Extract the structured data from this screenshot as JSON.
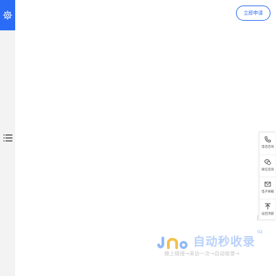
{
  "header": {
    "apply_label": "立即申请"
  },
  "sidebar": {
    "logo_icon": "gear-logo-icon",
    "menu_icon": "menu-list-icon",
    "accent_color": "#2b6cf6"
  },
  "contact_bar": {
    "items": [
      {
        "label": "电话咨询",
        "icon": "phone-icon"
      },
      {
        "label": "微信咨询",
        "icon": "wechat-icon"
      },
      {
        "label": "电子邮箱",
        "icon": "mail-icon"
      },
      {
        "label": "返回顶部",
        "icon": "back-to-top-icon"
      }
    ]
  },
  "page_number": "02",
  "watermark": {
    "title": "自动秒收录",
    "subtitle": "做上链接→来访一次→自动收录→"
  }
}
